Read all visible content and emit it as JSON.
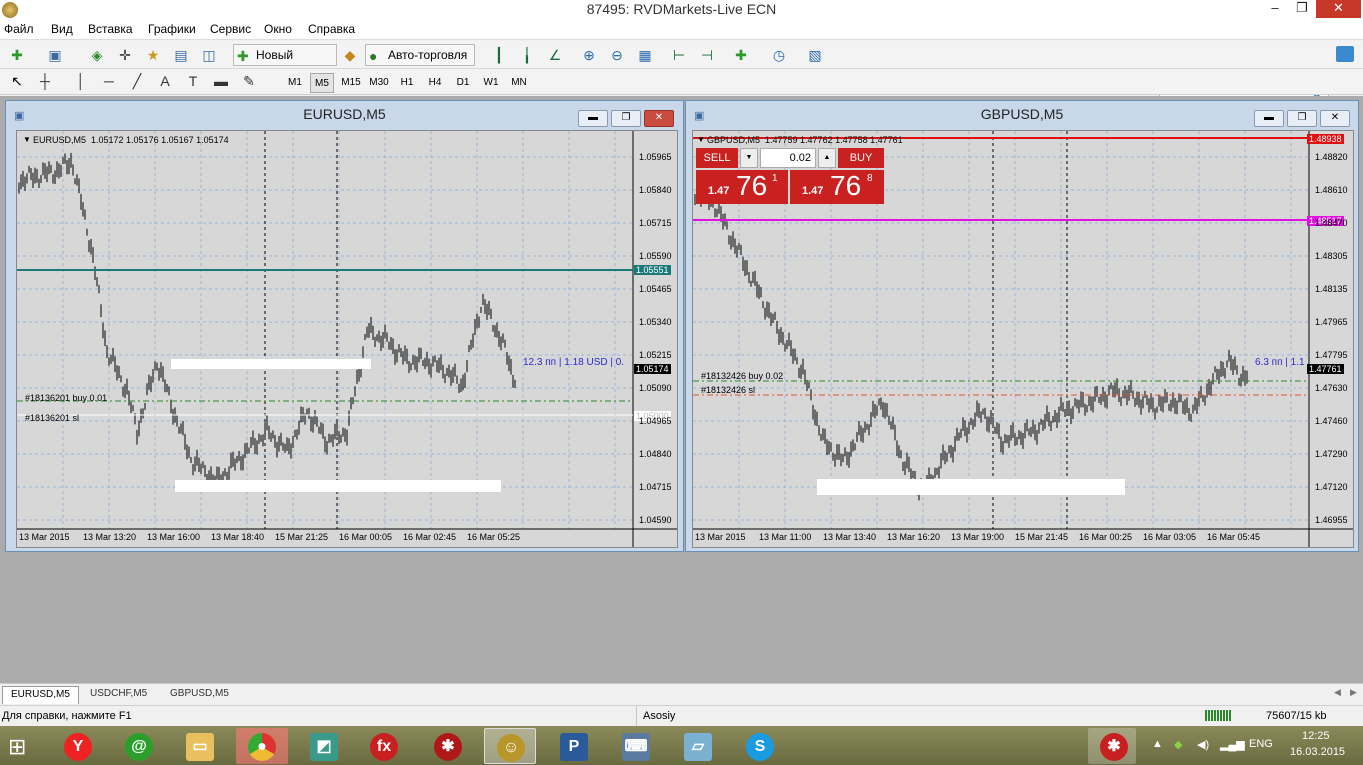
{
  "window": {
    "title": "87495: RVDMarkets-Live ECN",
    "min_glyph": "–",
    "max_glyph": "❐",
    "close_glyph": "✕"
  },
  "menu": [
    "Файл",
    "Вид",
    "Вставка",
    "Графики",
    "Сервис",
    "Окно",
    "Справка"
  ],
  "toolbar": {
    "new_order": "Новый Ордер",
    "auto_trading": "Авто-торговля"
  },
  "timeframes": [
    "M1",
    "M5",
    "M15",
    "M30",
    "H1",
    "H4",
    "D1",
    "W1",
    "MN"
  ],
  "active_timeframe": "M5",
  "charts": [
    {
      "caption": "EURUSD,M5",
      "header": "EURUSD,M5  1.05172 1.05176 1.05167 1.05174",
      "price_ticks": [
        "1.05965",
        "1.05840",
        "1.05715",
        "1.05590",
        "1.05465",
        "1.05340",
        "1.05215",
        "1.05090",
        "1.04965",
        "1.04840",
        "1.04715",
        "1.04590"
      ],
      "time_ticks": [
        "13 Mar 2015",
        "13 Mar 13:20",
        "13 Mar 16:00",
        "13 Mar 18:40",
        "15 Mar 21:25",
        "16 Mar 00:05",
        "16 Mar 02:45",
        "16 Mar 05:25"
      ],
      "hline_label": "1.05551",
      "current_price": "1.05174",
      "white_label": "1.05000",
      "profit_text": "12.3 пп | 1.18 USD | 0.",
      "order_buy": "#18136201 buy 0.01",
      "order_sl": "#18136201 sl",
      "colors": {
        "hline": "#1a7a7a",
        "current": "#000000",
        "buy_line": "#2a8a2a",
        "sl_line": "#e05530"
      }
    },
    {
      "caption": "GBPUSD,M5",
      "header": "GBPUSD,M5  1.47759 1.47762 1.47758 1.47761",
      "price_ticks": [
        "1.48820",
        "1.48610",
        "1.48470",
        "1.48305",
        "1.48135",
        "1.47965",
        "1.47795",
        "1.47630",
        "1.47460",
        "1.47290",
        "1.47120",
        "1.46955"
      ],
      "time_ticks": [
        "13 Mar 2015",
        "13 Mar 11:00",
        "13 Mar 13:40",
        "13 Mar 16:20",
        "13 Mar 19:00",
        "15 Mar 21:45",
        "16 Mar 00:25",
        "16 Mar 03:05",
        "16 Mar 05:45"
      ],
      "red_label": "1.48938",
      "magenta_label": "1.48517",
      "current_price": "1.47761",
      "profit_text": "6.3 пп | 1.1",
      "order_buy": "#18132426 buy 0.02",
      "order_sl": "#18132426 sl",
      "trade_panel": {
        "sell": "SELL",
        "buy": "BUY",
        "lot": "0.02",
        "sell_prefix": "1.47",
        "sell_big": "76",
        "sell_sup": "1",
        "buy_prefix": "1.47",
        "buy_big": "76",
        "buy_sup": "8"
      },
      "colors": {
        "red_line": "#e01010",
        "magenta_line": "#e010e0",
        "buy_line": "#2a8a2a",
        "sl_line": "#e05530"
      }
    }
  ],
  "tabs": [
    "EURUSD,M5",
    "USDCHF,M5",
    "GBPUSD,M5"
  ],
  "status": {
    "help": "Для справки, нажмите F1",
    "profile": "Asosiy",
    "traffic": "75607/15 kb"
  },
  "tray": {
    "lang": "ENG",
    "time": "12:25",
    "date": "16.03.2015"
  }
}
